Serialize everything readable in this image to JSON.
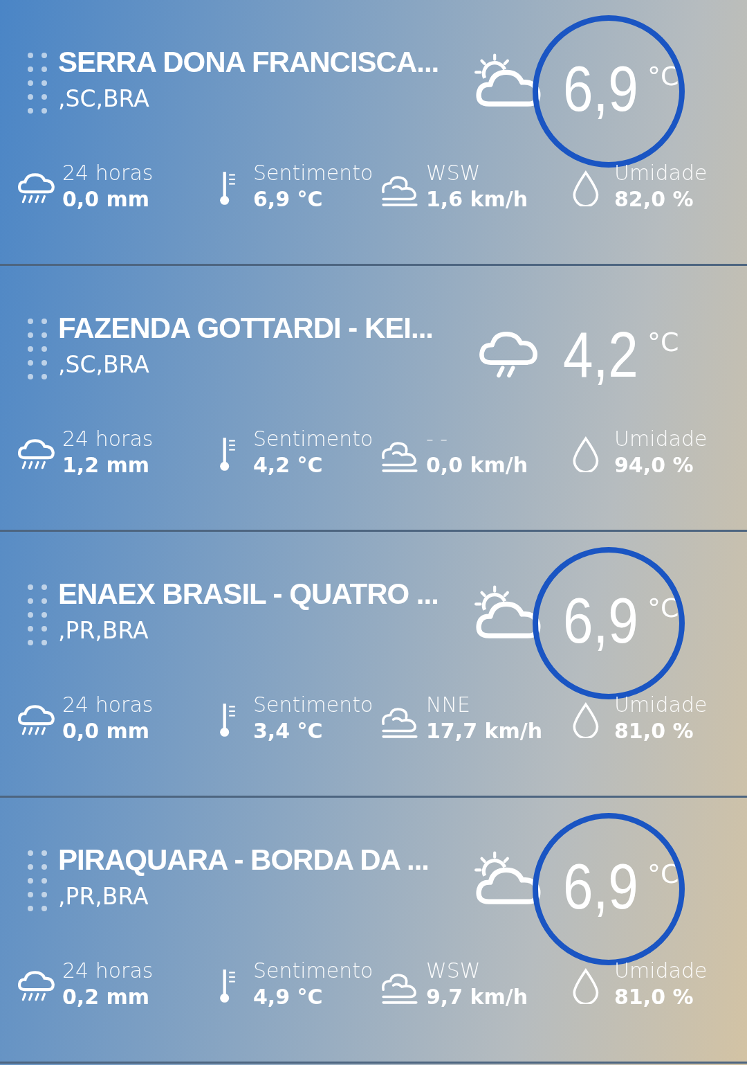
{
  "stations": [
    {
      "name": "SERRA DONA FRANCISCA...",
      "region": ",SC,BRA",
      "kind": "partly_cloudy",
      "temperature": "6,9",
      "unit": "°C",
      "circled": true,
      "stats": [
        {
          "kind": "rain",
          "label": "24 horas",
          "value": "0,0 mm"
        },
        {
          "kind": "feel",
          "label": "Sentimento",
          "value": "6,9 °C"
        },
        {
          "kind": "wind",
          "label": "WSW",
          "value": "1,6 km/h"
        },
        {
          "kind": "humidity",
          "label": "Umidade",
          "value": "82,0 %"
        }
      ]
    },
    {
      "name": "FAZENDA GOTTARDI - KEI...",
      "region": ",SC,BRA",
      "kind": "rain",
      "temperature": "4,2",
      "unit": "°C",
      "circled": false,
      "stats": [
        {
          "kind": "rain",
          "label": "24 horas",
          "value": "1,2 mm"
        },
        {
          "kind": "feel",
          "label": "Sentimento",
          "value": "4,2 °C"
        },
        {
          "kind": "wind",
          "label": "- -",
          "value": "0,0 km/h"
        },
        {
          "kind": "humidity",
          "label": "Umidade",
          "value": "94,0 %"
        }
      ]
    },
    {
      "name": "ENAEX BRASIL - QUATRO ...",
      "region": ",PR,BRA",
      "kind": "partly_cloudy",
      "temperature": "6,9",
      "unit": "°C",
      "circled": true,
      "stats": [
        {
          "kind": "rain",
          "label": "24 horas",
          "value": "0,0 mm"
        },
        {
          "kind": "feel",
          "label": "Sentimento",
          "value": "3,4 °C"
        },
        {
          "kind": "wind",
          "label": "NNE",
          "value": "17,7 km/h"
        },
        {
          "kind": "humidity",
          "label": "Umidade",
          "value": "81,0 %"
        }
      ]
    },
    {
      "name": "PIRAQUARA - BORDA DA ...",
      "region": ",PR,BRA",
      "kind": "partly_cloudy",
      "temperature": "6,9",
      "unit": "°C",
      "circled": true,
      "stats": [
        {
          "kind": "rain",
          "label": "24 horas",
          "value": "0,2 mm"
        },
        {
          "kind": "feel",
          "label": "Sentimento",
          "value": "4,9 °C"
        },
        {
          "kind": "wind",
          "label": "WSW",
          "value": "9,7 km/h"
        },
        {
          "kind": "humidity",
          "label": "Umidade",
          "value": "81,0 %"
        }
      ]
    }
  ]
}
